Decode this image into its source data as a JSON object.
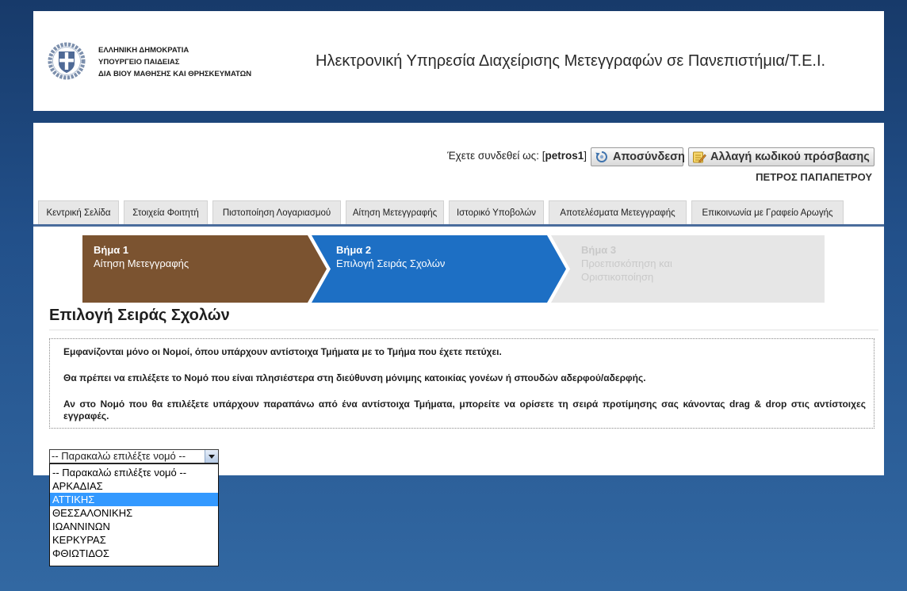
{
  "header": {
    "org_line1": "ΕΛΛΗΝΙΚΗ ΔΗΜΟΚΡΑΤΙΑ",
    "org_line2": "ΥΠΟΥΡΓΕΙΟ ΠΑΙΔΕΙΑΣ",
    "org_line3": "ΔΙΑ ΒΙΟΥ ΜΑΘΗΣΗΣ ΚΑΙ ΘΡΗΣΚΕΥΜΑΤΩΝ",
    "title": "Ηλεκτρονική Υπηρεσία Διαχείρισης Μετεγγραφών σε Πανεπιστήμια/Τ.Ε.Ι."
  },
  "session": {
    "prefix": "Έχετε συνδεθεί ως: [",
    "username": "petros1",
    "suffix": "]",
    "logout_label": "Αποσύνδεση",
    "change_password_label": "Αλλαγή κωδικού πρόσβασης",
    "full_name": "ΠΕΤΡΟΣ ΠΑΠΑΠΕΤΡΟΥ"
  },
  "tabs": [
    {
      "label": "Κεντρική Σελίδα"
    },
    {
      "label": "Στοιχεία Φοιτητή"
    },
    {
      "label": "Πιστοποίηση Λογαριασμού"
    },
    {
      "label": "Αίτηση Μετεγγραφής"
    },
    {
      "label": "Ιστορικό Υποβολών"
    },
    {
      "label": "Αποτελέσματα Μετεγγραφής"
    },
    {
      "label": "Επικοινωνία με Γραφείο Αρωγής"
    }
  ],
  "steps": [
    {
      "number": "Βήμα 1",
      "label": "Αίτηση Μετεγγραφής"
    },
    {
      "number": "Βήμα 2",
      "label": "Επιλογή Σειράς Σχολών"
    },
    {
      "number": "Βήμα 3",
      "label": "Προεπισκόπηση και Οριστικοποίηση"
    }
  ],
  "main": {
    "heading": "Επιλογή Σειράς Σχολών",
    "info": [
      "Εμφανίζονται μόνο οι Νομοί, όπου υπάρχουν αντίστοιχα Τμήματα με το Τμήμα που έχετε πετύχει.",
      "Θα πρέπει να επιλέξετε το Νομό που είναι πλησιέστερα στη διεύθυνση μόνιμης κατοικίας γονέων ή σπουδών αδερφού/αδερφής.",
      "Αν στο Νομό που θα επιλέξετε υπάρχουν παραπάνω από ένα αντίστοιχα Τμήματα, μπορείτε να ορίσετε τη σειρά προτίμησης σας κάνοντας drag & drop στις αντίστοιχες εγγραφές."
    ]
  },
  "region_select": {
    "selected": "-- Παρακαλώ επιλέξτε νομό --",
    "highlighted_option": "ΑΤΤΙΚΗΣ",
    "options": [
      "-- Παρακαλώ επιλέξτε νομό --",
      "ΑΡΚΑΔΙΑΣ",
      "ΑΤΤΙΚΗΣ",
      "ΘΕΣΣΑΛΟΝΙΚΗΣ",
      "ΙΩΑΝΝΙΝΩΝ",
      "ΚΕΡΚΥΡΑΣ",
      "ΦΘΙΩΤΙΔΟΣ"
    ]
  },
  "icons": {
    "logo": "greek-coat-of-arms-icon",
    "logout": "logout-icon",
    "change_password": "notepad-pencil-icon",
    "select_arrow": "chevron-down-icon"
  },
  "colors": {
    "step_completed": "#7b5330",
    "step_active": "#1d6fc4",
    "step_pending": "#e6e6e6",
    "step_pending_text": "#c9c9c9",
    "tab_underline": "#4a6c9c",
    "option_highlight": "#3399ff"
  }
}
